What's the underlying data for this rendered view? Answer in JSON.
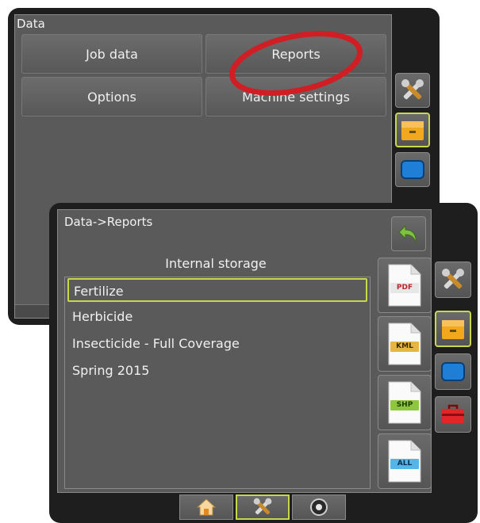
{
  "back_screen": {
    "title": "Data",
    "buttons": [
      "Job data",
      "Reports",
      "Options",
      "Machine settings"
    ],
    "side_icons": [
      "tools-icon",
      "data-drawer-icon",
      "display-icon"
    ]
  },
  "front_screen": {
    "title": "Data->Reports",
    "storage_label": "Internal storage",
    "reports": [
      "Fertilize",
      "Herbicide",
      "Insecticide - Full Coverage",
      "Spring 2015"
    ],
    "selected_report": "Fertilize",
    "export_buttons": [
      "PDF",
      "KML",
      "SHP",
      "ALL"
    ],
    "side_icons": [
      "tools-icon",
      "data-drawer-icon",
      "display-icon",
      "toolbox-icon"
    ],
    "bottom_nav": [
      "home-icon",
      "tools-icon",
      "camera-icon"
    ]
  },
  "colors": {
    "highlight": "#c8d84a",
    "annotation_ring": "#cf1f25",
    "pdf_tag": "#e7e7e7",
    "kml_tag": "#e7b541",
    "shp_tag": "#8ec63f",
    "all_tag": "#56b4e6"
  }
}
